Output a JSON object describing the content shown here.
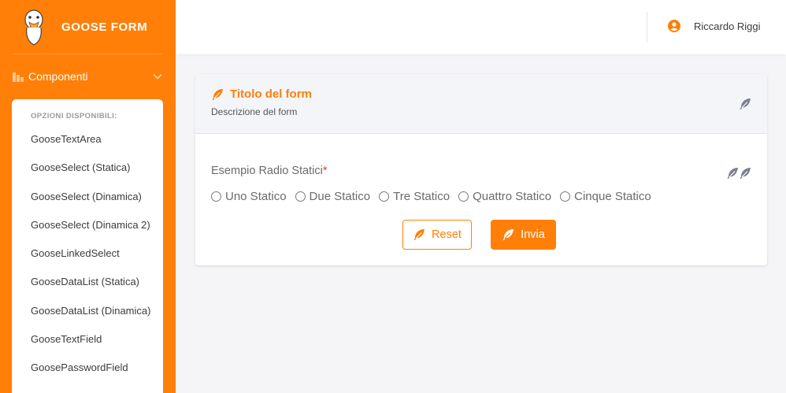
{
  "brand": {
    "name": "GOOSE FORM"
  },
  "sidebar": {
    "menu_label": "Componenti",
    "section_title": "OPZIONI DISPONIBILI:",
    "items": [
      "GooseTextArea",
      "GooseSelect (Statica)",
      "GooseSelect (Dinamica)",
      "GooseSelect (Dinamica 2)",
      "GooseLinkedSelect",
      "GooseDataList (Statica)",
      "GooseDataList (Dinamica)",
      "GooseTextField",
      "GoosePasswordField"
    ]
  },
  "topbar": {
    "user_name": "Riccardo Riggi"
  },
  "form": {
    "title": "Titolo del form",
    "description": "Descrizione del form",
    "field_label": "Esempio Radio Statici",
    "required_mark": "*",
    "options": [
      "Uno Statico",
      "Due Statico",
      "Tre Statico",
      "Quattro Statico",
      "Cinque Statico"
    ],
    "reset_label": "Reset",
    "submit_label": "Invia"
  },
  "colors": {
    "accent": "#ff7f08",
    "icon_gray": "#7c7f93"
  },
  "icons": [
    "goose-logo",
    "chart-icon",
    "chevron-down-icon",
    "user-circle-icon",
    "feather-icon"
  ]
}
